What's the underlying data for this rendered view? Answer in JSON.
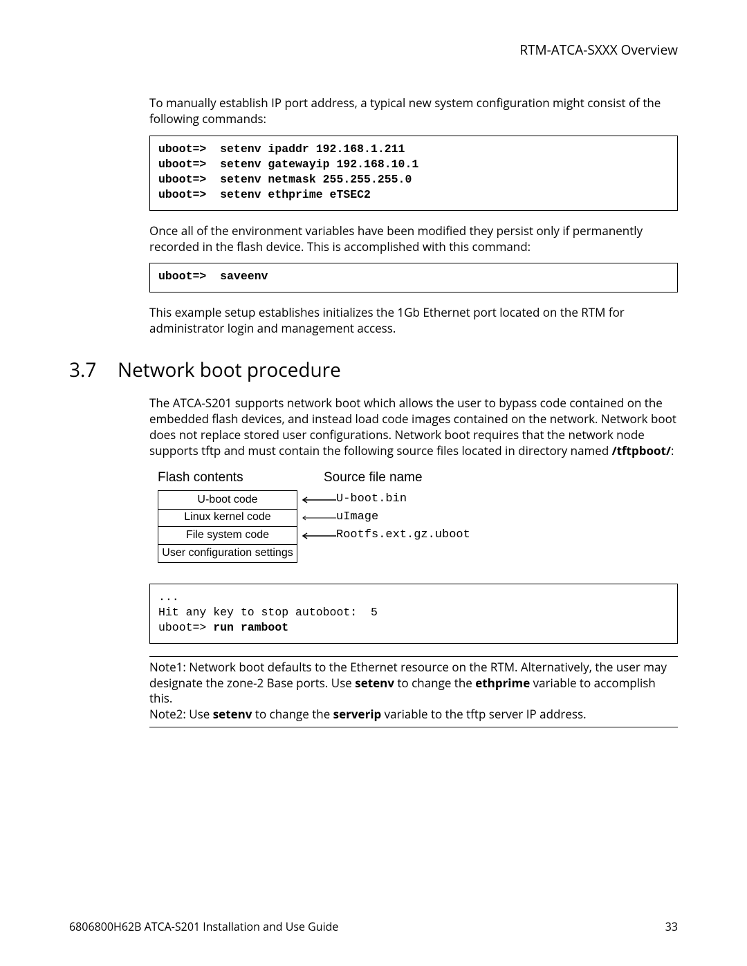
{
  "header": {
    "title": "RTM-ATCA-SXXX Overview"
  },
  "intro1": "To manually establish IP port address, a typical new system configuration might consist of the following commands:",
  "code1": "uboot=>  setenv ipaddr 192.168.1.211\nuboot=>  setenv gatewayip 192.168.10.1\nuboot=>  setenv netmask 255.255.255.0\nuboot=>  setenv ethprime eTSEC2",
  "para2": "Once all of the environment variables have been modified they persist only if permanently recorded in the flash device.   This is accomplished with this command:",
  "code2": "uboot=>  saveenv",
  "para3": "This example setup establishes initializes the 1Gb Ethernet port located on the RTM for administrator login and management access.",
  "section": {
    "num": "3.7",
    "title": "Network boot procedure"
  },
  "para4_a": "The ATCA-S201 supports network boot which allows the user to bypass code contained on the embedded flash devices, and instead load code images contained on the network.  Network boot does not replace stored user configurations.  Network boot requires that the network node supports tftp and must contain the following source files located in directory named ",
  "para4_b": "/tftpboot/",
  "para4_c": ":",
  "diagram": {
    "h_left": "Flash contents",
    "h_right": "Source file name",
    "rows": [
      {
        "flash": "U-boot code",
        "src": "U-boot.bin"
      },
      {
        "flash": "Linux kernel code",
        "src": "uImage"
      },
      {
        "flash": "File system code",
        "src": "Rootfs.ext.gz.uboot"
      },
      {
        "flash": "User configuration settings",
        "src": ""
      }
    ]
  },
  "code3_a": "...\nHit any key to stop autoboot:  5\nuboot=> ",
  "code3_b": "run ramboot",
  "note1_a": "Note1: Network boot defaults to the Ethernet resource on the RTM.  Alternatively, the user may designate the zone-2 Base ports.  Use ",
  "note1_b": "setenv",
  "note1_c": " to change the ",
  "note1_d": "ethprime",
  "note1_e": " variable to accomplish this.",
  "note2_a": "Note2: Use ",
  "note2_b": "setenv",
  "note2_c": " to change the ",
  "note2_d": "serverip",
  "note2_e": " variable to the tftp server IP address.",
  "footer": {
    "left": "6806800H62B ATCA-S201 Installation and Use Guide",
    "right": "33"
  }
}
